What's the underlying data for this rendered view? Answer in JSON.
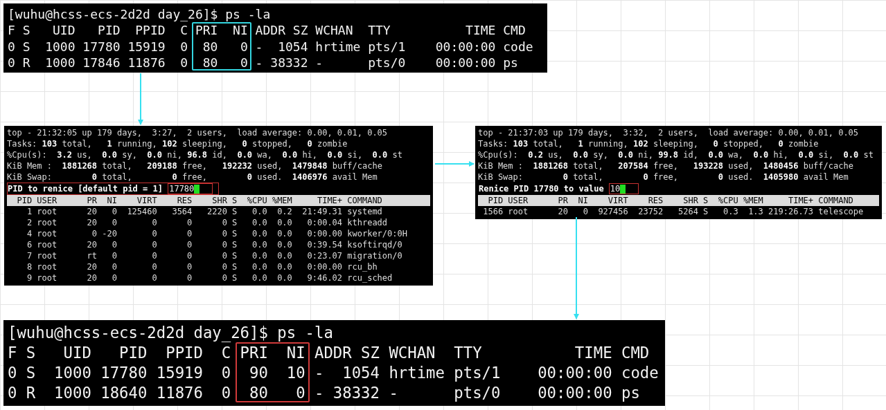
{
  "panels": [
    {
      "kind": "ps",
      "command": "[wuhu@hcss-ecs-2d2d day_26]$ ps -la",
      "header": "F S   UID   PID  PPID  C PRI  NI ADDR SZ WCHAN  TTY          TIME CMD",
      "rows": [
        "0 S  1000 17780 15919  0  80   0 -  1054 hrtime pts/1    00:00:00 code",
        "0 R  1000 17846 11876  0  80   0 - 38332 -      pts/0    00:00:00 ps"
      ],
      "color": "#33d6e0"
    },
    {
      "kind": "top",
      "summary": [
        "top - 21:32:05 up 179 days,  3:27,  2 users,  load average: 0.00, 0.01, 0.05",
        "Tasks: **103** total,   **1** running, **102** sleeping,   **0** stopped,   **0** zombie",
        "%Cpu(s):  **3.2** us,  **0.0** sy,  **0.0** ni, **96.8** id,  **0.0** wa,  **0.0** hi,  **0.0** si,  **0.0** st",
        "KiB Mem :  **1881268** total,   **209188** free,   **192232** used,  **1479848** buff/cache",
        "KiB Swap:        **0** total,        **0** free,        **0** used.  **1406976** avail Mem"
      ],
      "prompt": "PID to renice [default pid = 1]",
      "value": "17780",
      "prompt_outlined": true,
      "header": "  PID USER      PR  NI    VIRT    RES    SHR S  %CPU %MEM     TIME+ COMMAND",
      "rows": [
        "    1 root      20   0  125460   3564   2220 S   0.0  0.2  21:49.31 systemd",
        "    2 root      20   0       0      0      0 S   0.0  0.0   0:00.04 kthreadd",
        "    4 root       0 -20       0      0      0 S   0.0  0.0   0:00.00 kworker/0:0H",
        "    6 root      20   0       0      0      0 S   0.0  0.0   0:39.54 ksoftirqd/0",
        "    7 root      rt   0       0      0      0 S   0.0  0.0   0:23.07 migration/0",
        "    8 root      20   0       0      0      0 S   0.0  0.0   0:00.00 rcu_bh",
        "    9 root      20   0       0      0      0 S   0.0  0.0   9:46.02 rcu_sched"
      ]
    },
    {
      "kind": "top",
      "summary": [
        "top - 21:37:03 up 179 days,  3:32,  2 users,  load average: 0.00, 0.01, 0.05",
        "Tasks: **103** total,   **1** running, **102** sleeping,   **0** stopped,   **0** zombie",
        "%Cpu(s):  **0.2** us,  **0.0** sy,  **0.0** ni, **99.8** id,  **0.0** wa,  **0.0** hi,  **0.0** si,  **0.0** st",
        "KiB Mem :  **1881268** total,   **207584** free,   **193228** used,  **1480456** buff/cache",
        "KiB Swap:        **0** total,        **0** free,        **0** used.  **1405980** avail Mem"
      ],
      "prompt": "Renice PID 17780 to value",
      "value": "10",
      "prompt_outlined": false,
      "header": "  PID USER      PR  NI    VIRT    RES    SHR S  %CPU %MEM     TIME+ COMMAND",
      "rows": [
        " 1566 root      20   0  927456  23752   5264 S   0.3  1.3 219:26.73 telescope"
      ]
    },
    {
      "kind": "ps",
      "command": "[wuhu@hcss-ecs-2d2d day_26]$ ps -la",
      "header": "F S   UID   PID  PPID  C PRI  NI ADDR SZ WCHAN  TTY          TIME CMD",
      "rows": [
        "0 S  1000 17780 15919  0  90  10 -  1054 hrtime pts/1    00:00:00 code",
        "0 R  1000 18640 11876  0  80   0 - 38332 -      pts/0    00:00:00 ps"
      ],
      "color": "#d03a3a"
    }
  ]
}
